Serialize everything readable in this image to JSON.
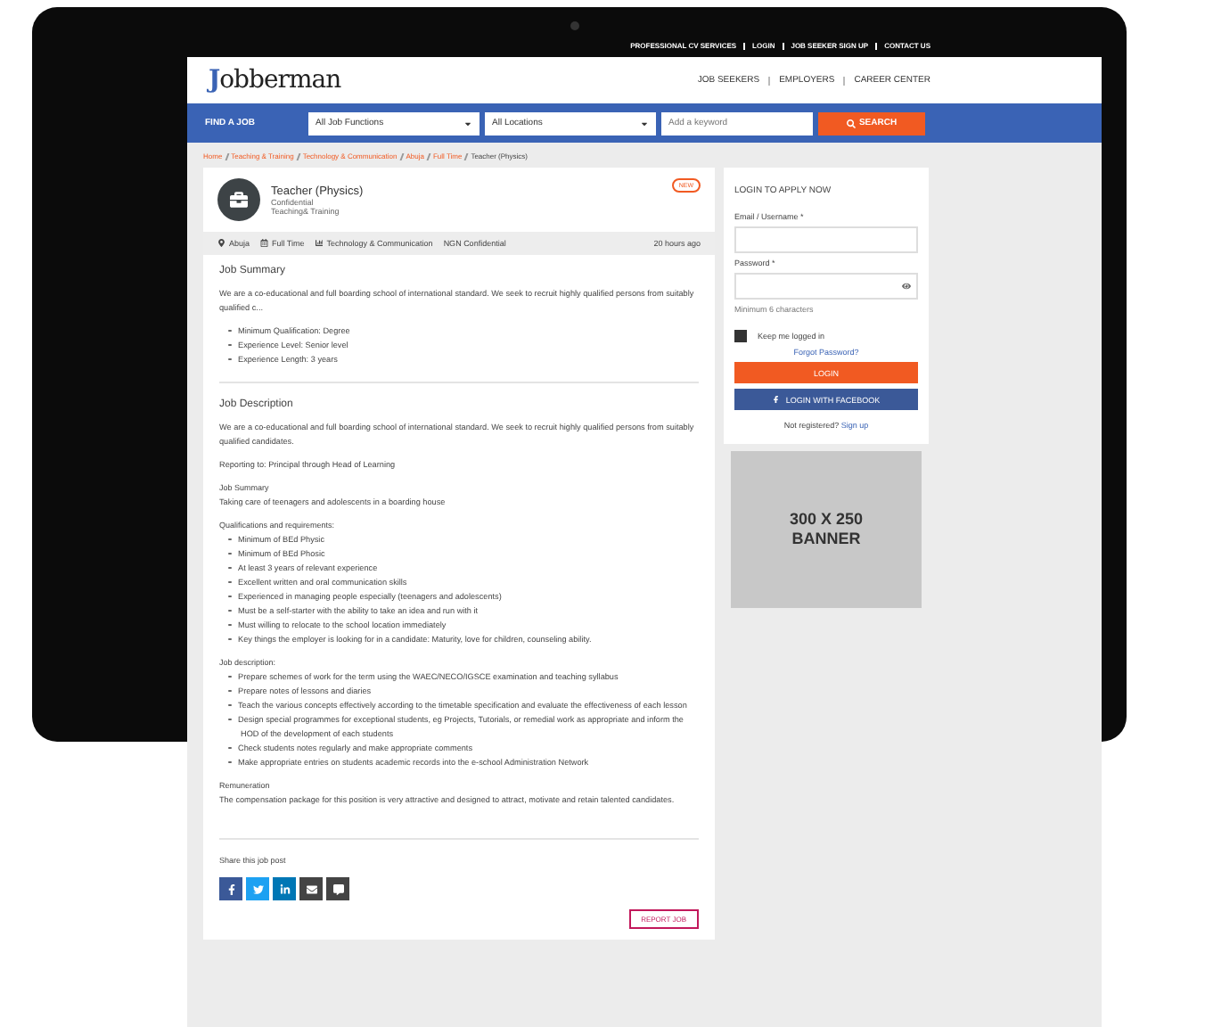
{
  "top_links": [
    "PROFESSIONAL CV SERVICES",
    "LOGIN",
    "JOB SEEKER SIGN UP",
    "CONTACT US"
  ],
  "logo": "Jobberman",
  "nav": [
    "JOB SEEKERS",
    "EMPLOYERS",
    "CAREER CENTER"
  ],
  "search": {
    "label": "FIND A JOB",
    "function_select": "All Job Functions",
    "location_select": "All Locations",
    "keyword_placeholder": "Add a keyword",
    "button": "SEARCH"
  },
  "breadcrumb": [
    {
      "label": "Home",
      "current": false
    },
    {
      "label": "Teaching & Training",
      "current": false
    },
    {
      "label": "Technology & Communication",
      "current": false
    },
    {
      "label": "Abuja",
      "current": false
    },
    {
      "label": "Full Time",
      "current": false
    },
    {
      "label": "Teacher (Physics)",
      "current": true
    }
  ],
  "job": {
    "title": "Teacher (Physics)",
    "company": "Confidential",
    "category": "Teaching& Training",
    "badge": "NEW",
    "meta": [
      {
        "kind": "location",
        "text": "Abuja"
      },
      {
        "kind": "type",
        "text": "Full Time"
      },
      {
        "kind": "field",
        "text": "Technology & Communication"
      },
      {
        "kind": "salary",
        "text": "NGN Confidential"
      }
    ],
    "posted": "20 hours ago",
    "summary": {
      "heading": "Job Summary",
      "text": "We are a co-educational and full boarding school of international standard.  We seek to recruit highly qualified persons from suitably qualified c...",
      "bullets": [
        "Minimum Qualification: Degree",
        "Experience Level: Senior level",
        "Experience Length: 3 years"
      ]
    },
    "description_heading": "Job Description",
    "blocks": [
      {
        "kind": "paragraph",
        "text": "We are a co-educational and full boarding school of international standard.  We seek to recruit highly qualified persons from suitably qualified candidates."
      },
      {
        "kind": "paragraph",
        "text": "Reporting to: Principal through Head of Learning"
      },
      {
        "kind": "titled",
        "title": "Job Summary",
        "text": "Taking care of teenagers and adolescents in a boarding house"
      },
      {
        "kind": "list",
        "title": "Qualifications and requirements:",
        "items": [
          "Minimum of BEd Physic",
          "Minimum of BEd Phosic",
          "At least 3 years of relevant experience",
          "Excellent written and oral communication skills",
          "Experienced in managing people especially (teenagers and adolescents)",
          "Must be a self-starter with the ability to take an idea and run with it",
          "Must willing to relocate to the school location immediately",
          "Key things the employer is looking for in a candidate: Maturity, love for children, counseling ability."
        ]
      },
      {
        "kind": "list",
        "title": "Job description:",
        "items": [
          "Prepare schemes of work for the term using the WAEC/NECO/IGSCE examination and teaching syllabus",
          "Prepare notes of lessons and diaries",
          "Teach the various concepts effectively according to the timetable specification and evaluate the effectiveness of each lesson",
          "Design special programmes for exceptional students, eg Projects, Tutorials, or remedial work as appropriate and inform the HOD of the development of each students",
          "Check students notes regularly and make appropriate comments",
          "Make appropriate entries on students academic records into the e-school Administration Network"
        ]
      },
      {
        "kind": "titled",
        "title": "Remuneration",
        "text": "The compensation package for this position is very attractive and designed to attract, motivate and retain talented candidates."
      }
    ],
    "share_label": "Share this job post",
    "share_buttons": [
      {
        "kind": "facebook"
      },
      {
        "kind": "twitter"
      },
      {
        "kind": "linkedin"
      },
      {
        "kind": "email"
      },
      {
        "kind": "message"
      }
    ],
    "report_button": "REPORT JOB"
  },
  "login": {
    "title": "LOGIN TO APPLY NOW",
    "email_label": "Email / Username *",
    "password_label": "Password *",
    "hint": "Minimum 6 characters",
    "keep_logged_in": {
      "label": "Keep me logged in",
      "checked": true
    },
    "forgot": "Forgot Password?",
    "login_button": "LOGIN",
    "facebook_button": "LOGIN WITH FACEBOOK",
    "signup_prompt": "Not registered?",
    "signup_link": "Sign up"
  },
  "banner": [
    "300 X 250",
    "BANNER"
  ]
}
